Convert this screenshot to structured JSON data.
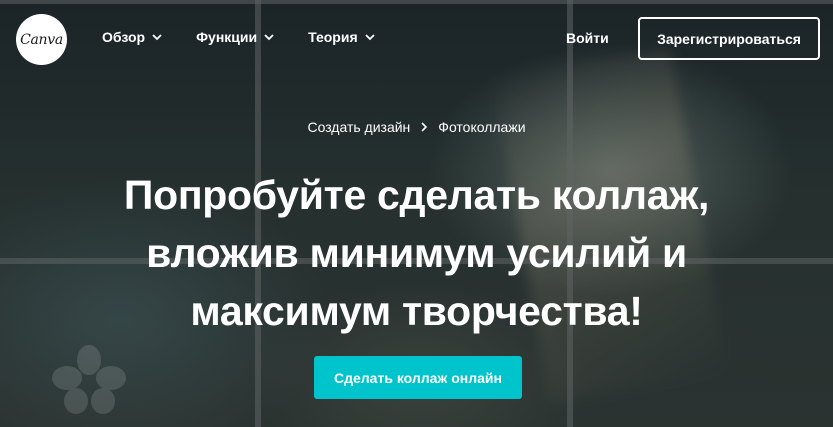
{
  "header": {
    "logo_text": "Canva",
    "nav": [
      {
        "label": "Обзор"
      },
      {
        "label": "Функции"
      },
      {
        "label": "Теория"
      }
    ],
    "login_label": "Войти",
    "signup_label": "Зарегистрироваться"
  },
  "breadcrumb": {
    "items": [
      "Создать дизайн",
      "Фотоколлажи"
    ]
  },
  "hero": {
    "headline_lines": [
      "Попробуйте сделать коллаж,",
      "вложив минимум усилий и",
      "максимум творчества!"
    ],
    "cta_label": "Сделать коллаж онлайн"
  },
  "colors": {
    "accent": "#00c4cc",
    "text": "#ffffff",
    "background": "#1c2528"
  }
}
